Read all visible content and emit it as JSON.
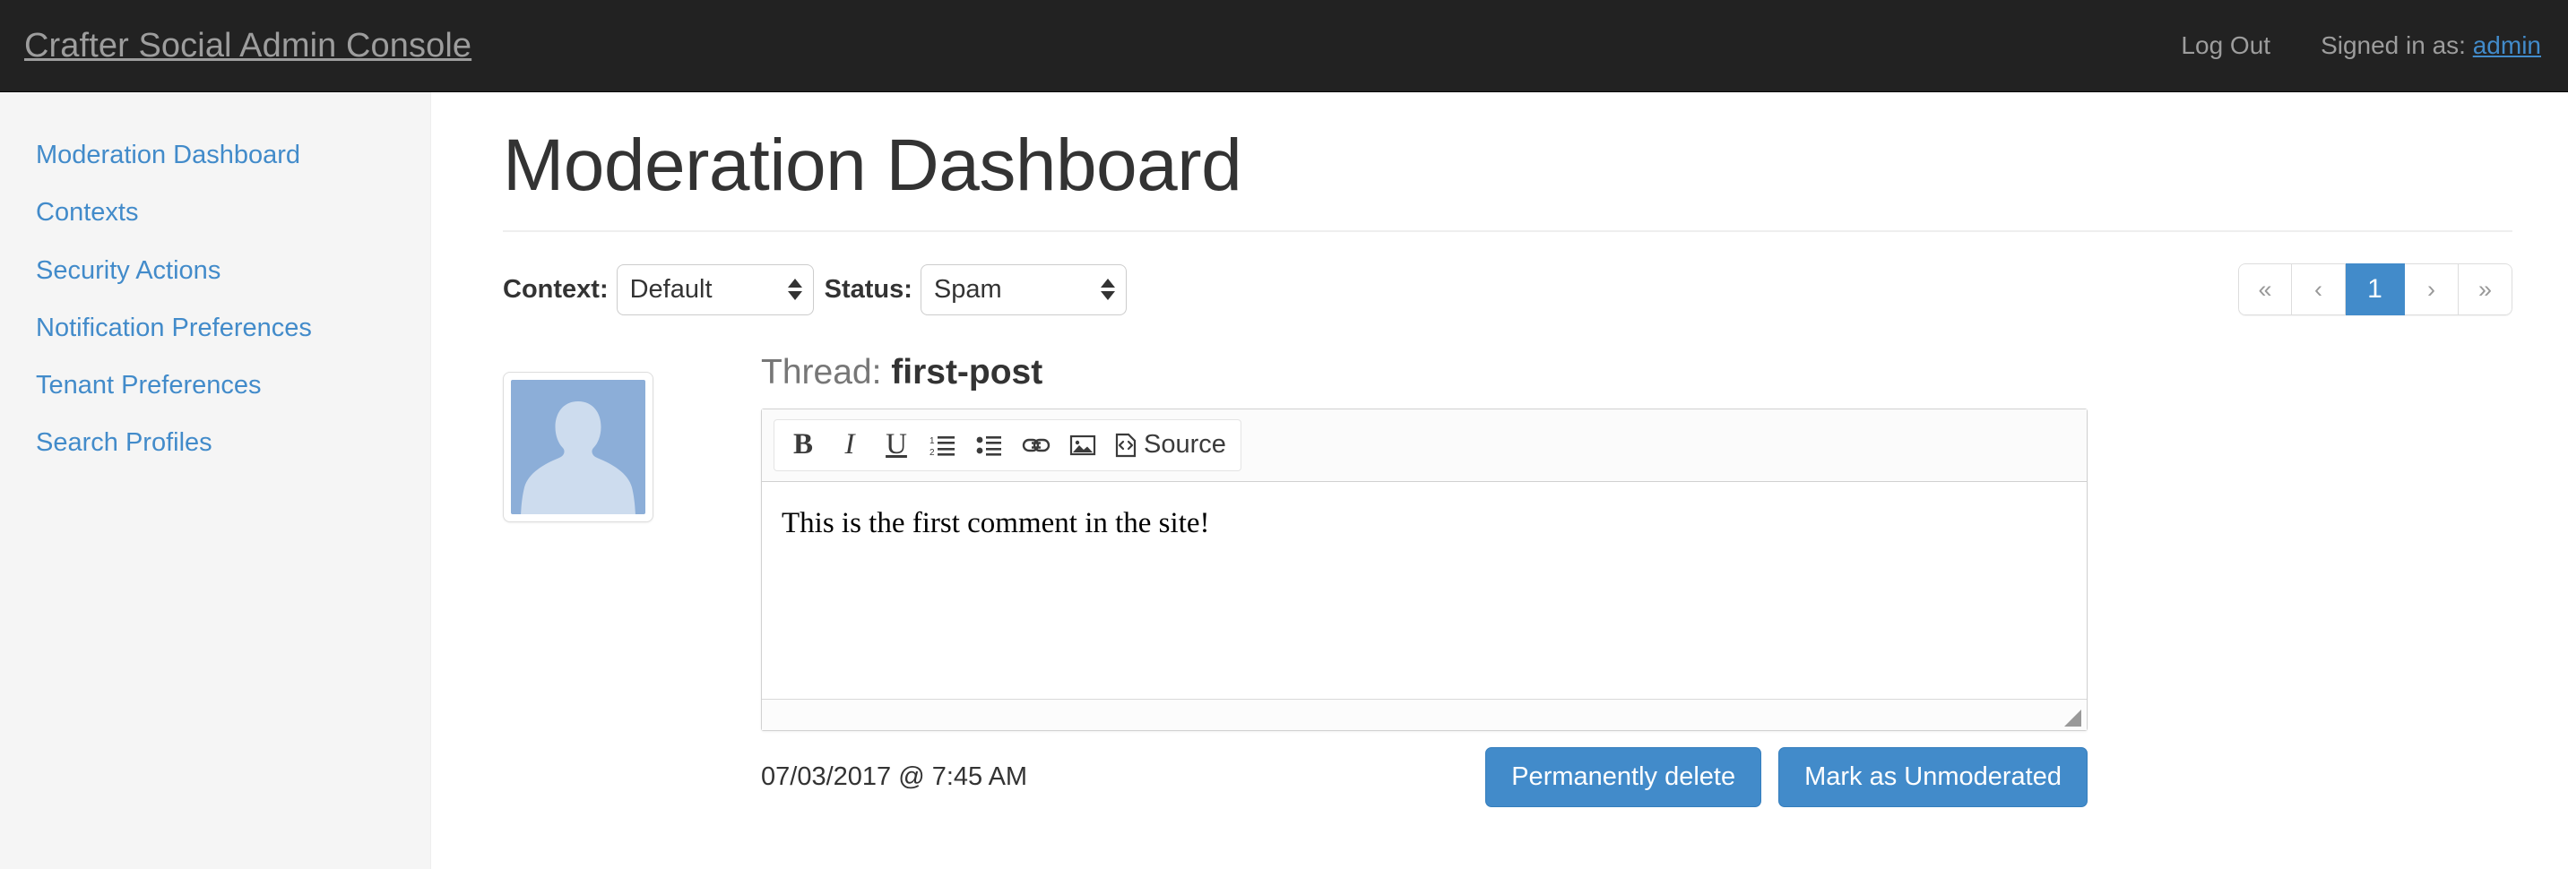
{
  "navbar": {
    "brand": "Crafter Social Admin Console",
    "logout_label": "Log Out",
    "signed_in_prefix": "Signed in as:",
    "signed_in_user": "admin"
  },
  "sidebar": {
    "items": [
      {
        "label": "Moderation Dashboard"
      },
      {
        "label": "Contexts"
      },
      {
        "label": "Security Actions"
      },
      {
        "label": "Notification Preferences"
      },
      {
        "label": "Tenant Preferences"
      },
      {
        "label": "Search Profiles"
      }
    ]
  },
  "main": {
    "page_title": "Moderation Dashboard",
    "filters": {
      "context_label": "Context:",
      "context_value": "Default",
      "context_options": [
        "Default"
      ],
      "status_label": "Status:",
      "status_value": "Spam",
      "status_options": [
        "Spam"
      ]
    },
    "pagination": {
      "first": "«",
      "prev": "‹",
      "current": "1",
      "next": "›",
      "last": "»"
    },
    "post": {
      "thread_prefix": "Thread:",
      "thread_name": "first-post",
      "editor": {
        "toolbar": [
          {
            "name": "bold",
            "label": "B"
          },
          {
            "name": "italic",
            "label": "I"
          },
          {
            "name": "underline",
            "label": "U"
          },
          {
            "name": "numbered-list",
            "label": ""
          },
          {
            "name": "bulleted-list",
            "label": ""
          },
          {
            "name": "link",
            "label": ""
          },
          {
            "name": "image",
            "label": ""
          },
          {
            "name": "source",
            "label": "Source"
          }
        ],
        "content": "This is the first comment in the site!"
      },
      "timestamp": "07/03/2017 @ 7:45 AM",
      "delete_label": "Permanently delete",
      "unmoderate_label": "Mark as Unmoderated"
    }
  },
  "colors": {
    "navbar_bg": "#222222",
    "sidebar_bg": "#f5f5f5",
    "link": "#428bca",
    "primary_button": "#428bca",
    "avatar_bg": "#8caed8",
    "avatar_figure": "#cddcee"
  }
}
